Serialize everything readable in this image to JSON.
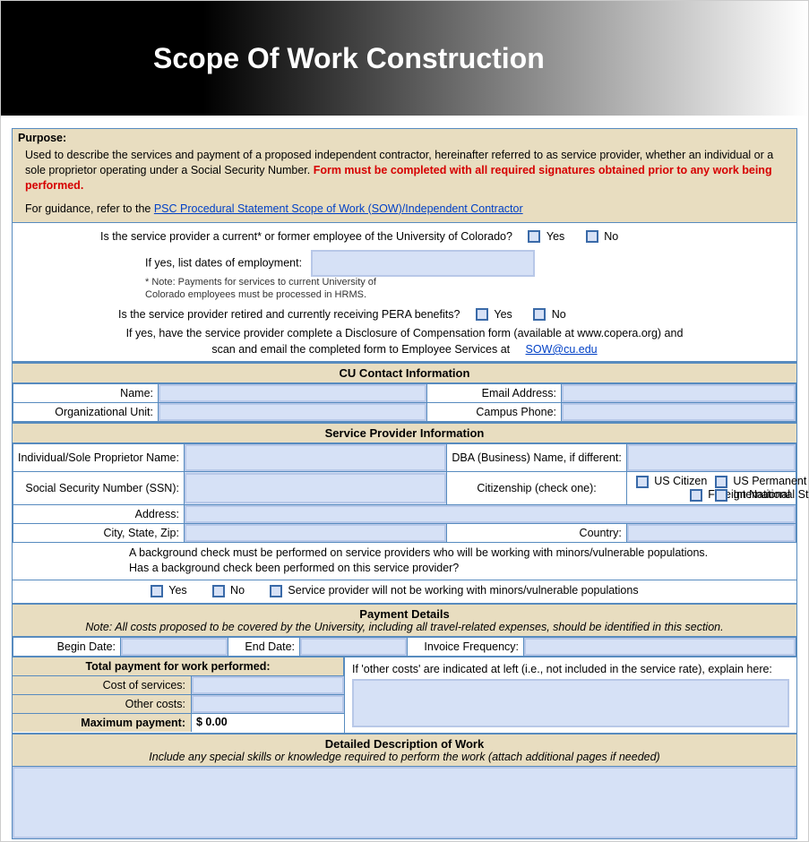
{
  "header": {
    "title": "Scope Of Work Construction"
  },
  "purpose": {
    "label": "Purpose:",
    "text_a": "Used to describe the services and payment of a proposed independent contractor, hereinafter referred to as service provider, whether an individual or a sole proprietor operating under a Social Security Number. ",
    "text_red": "Form must be completed with all required signatures obtained prior to any work being performed.",
    "guidance_prefix": "For guidance, refer to the ",
    "guidance_link": "PSC Procedural Statement Scope of Work (SOW)/Independent Contractor"
  },
  "q1": {
    "question": "Is the service provider a current* or former employee of the University of Colorado?",
    "yes": "Yes",
    "no": "No",
    "ifyes_label": "If yes, list dates of employment:",
    "note": "* Note: Payments for services to current University of Colorado employees must be processed in HRMS."
  },
  "q2": {
    "question": "Is the service provider retired and currently receiving PERA benefits?",
    "yes": "Yes",
    "no": "No",
    "pera_a": "If yes, have the service provider complete a Disclosure of Compensation form (available at www.copera.org) and",
    "pera_b": "scan and email the completed form to Employee Services at",
    "email": "SOW@cu.edu"
  },
  "cu": {
    "hdr": "CU Contact Information",
    "name": "Name:",
    "email": "Email Address:",
    "org": "Organizational Unit:",
    "phone": "Campus Phone:"
  },
  "sp": {
    "hdr": "Service Provider Information",
    "indiv": "Individual/Sole Proprietor Name:",
    "dba": "DBA (Business) Name, if different:",
    "ssn": "Social Security Number (SSN):",
    "cit_label": "Citizenship (check one):",
    "cit": {
      "us": "US Citizen",
      "pr": "US Permanent Resident",
      "fn": "Foreign National",
      "intl": "International Student"
    },
    "address": "Address:",
    "csz": "City, State, Zip:",
    "country": "Country:",
    "bg_a": "A background check must be performed on service providers who will be working with minors/vulnerable populations.",
    "bg_b": "Has a background check been performed on this service provider?",
    "bg_yes": "Yes",
    "bg_no": "No",
    "bg_notwork": "Service provider will not be working with minors/vulnerable populations"
  },
  "pay": {
    "hdr": "Payment Details",
    "sub": "Note:  All  costs proposed to be covered by the University, including all travel-related expenses, should be identified in this section.",
    "begin": "Begin Date:",
    "end": "End Date:",
    "freq": "Invoice Frequency:",
    "total_label": "Total payment for work performed:",
    "cost_label": "Cost of services:",
    "other_label": "Other costs:",
    "max_label": "Maximum payment:",
    "max_value": "$ 0.00",
    "explain": "If 'other costs' are indicated at left (i.e., not included in the service rate), explain here:"
  },
  "desc": {
    "hdr": "Detailed Description of Work",
    "sub": "Include any special skills or knowledge required to perform the work (attach additional pages if needed)"
  }
}
